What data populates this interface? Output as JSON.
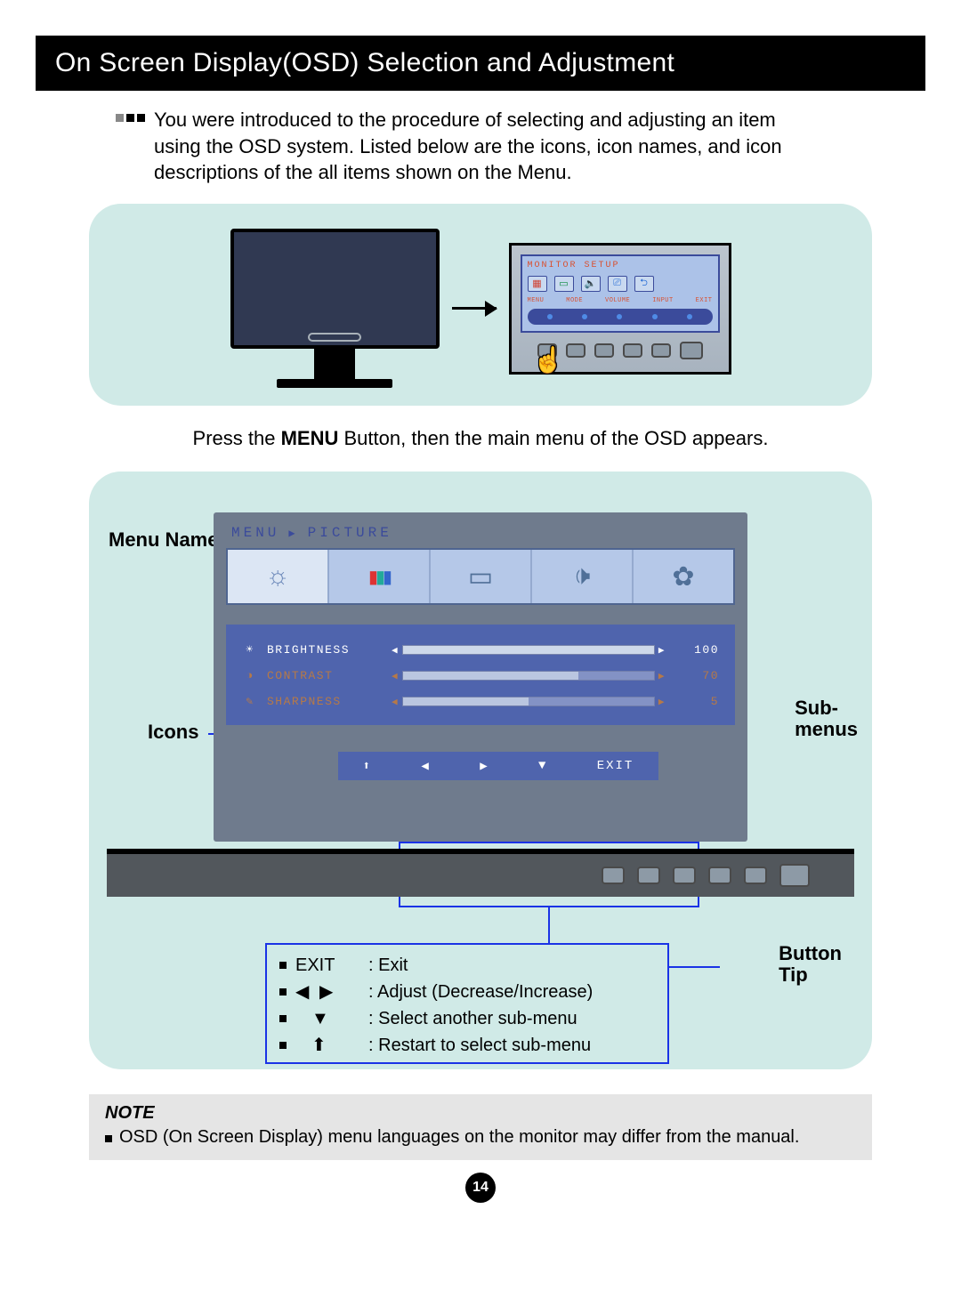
{
  "title": "On Screen Display(OSD) Selection and Adjustment",
  "intro": "You were introduced to the procedure of selecting and adjusting an item using the OSD system. Listed below are the icons, icon names, and icon descriptions of the all items shown on the Menu.",
  "panelA": {
    "osdTitle": "MONITOR SETUP",
    "miniLabels": [
      "MENU",
      "MODE",
      "VOLUME",
      "INPUT",
      "EXIT"
    ],
    "captionPrefix": "Press the ",
    "captionBold": "MENU",
    "captionSuffix": " Button, then the main menu of the OSD appears."
  },
  "labels": {
    "menuName": "Menu Name",
    "icons": "Icons",
    "submenus": "Sub-\nmenus",
    "buttonTip": "Button\nTip"
  },
  "osd": {
    "crumb1": "MENU",
    "crumb2": "PICTURE",
    "tabs": [
      {
        "id": "brightness-tab",
        "glyph": "☼",
        "selected": true
      },
      {
        "id": "color-tab",
        "glyph": "▮▮▮",
        "selected": false
      },
      {
        "id": "display-tab",
        "glyph": "▭",
        "selected": false
      },
      {
        "id": "volume-tab",
        "glyph": "🔈",
        "selected": false
      },
      {
        "id": "others-tab",
        "glyph": "⚙",
        "selected": false
      }
    ],
    "rows": [
      {
        "icon": "☀",
        "label": "BRIGHTNESS",
        "value": "100",
        "fill": "b100",
        "sel": true
      },
      {
        "icon": "◑",
        "label": "CONTRAST",
        "value": "70",
        "fill": "b70",
        "sel": false
      },
      {
        "icon": "✎",
        "label": "SHARPNESS",
        "value": "5",
        "fill": "b50",
        "sel": false
      }
    ],
    "footer": {
      "restart": "⬆",
      "left": "◀",
      "right": "▶",
      "down": "▼",
      "exit": "EXIT"
    }
  },
  "tips": [
    {
      "key": "EXIT",
      "sym": false,
      "desc": "Exit"
    },
    {
      "key": "◀ ▶",
      "sym": true,
      "desc": "Adjust (Decrease/Increase)"
    },
    {
      "key": "▼",
      "sym": true,
      "desc": "Select another sub-menu"
    },
    {
      "key": "⬆",
      "sym": true,
      "desc": "Restart to select sub-menu"
    }
  ],
  "note": {
    "header": "NOTE",
    "body": "OSD (On Screen Display) menu languages on the monitor may differ from the manual."
  },
  "page": "14"
}
